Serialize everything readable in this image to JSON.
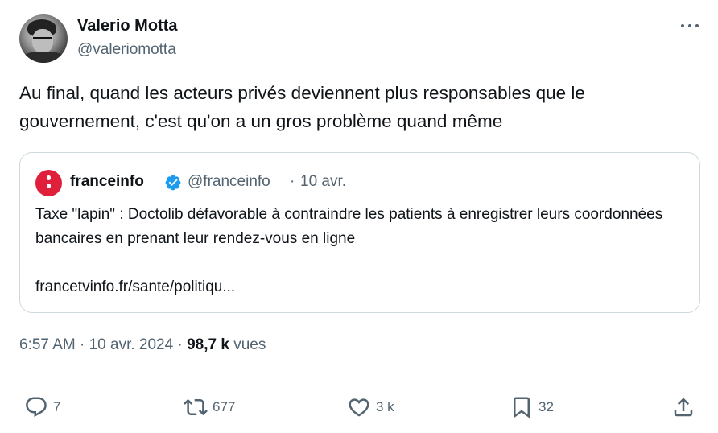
{
  "author": {
    "name": "Valerio Motta",
    "handle": "@valeriomotta"
  },
  "tweet": {
    "text": "Au final, quand les acteurs privés deviennent plus responsables que le gouvernement, c'est qu'on a un gros problème quand même"
  },
  "quote": {
    "name": "franceinfo",
    "handle": "@franceinfo",
    "separator": "·",
    "date": "10 avr.",
    "text": "Taxe \"lapin\" : Doctolib défavorable à contraindre les patients à enregistrer leurs coordonnées bancaires en prenant leur rendez-vous en ligne",
    "link": "francetvinfo.fr/sante/politiqu..."
  },
  "meta": {
    "time": "6:57 AM",
    "sep1": "·",
    "date": "10 avr. 2024",
    "sep2": "·",
    "views_count": "98,7 k",
    "views_label": "vues"
  },
  "actions": {
    "replies": "7",
    "reposts": "677",
    "likes": "3 k",
    "bookmarks": "32"
  },
  "icons": {
    "more": "more-horizontal-icon",
    "verified": "verified-badge-icon",
    "reply": "reply-icon",
    "repost": "repost-icon",
    "like": "heart-icon",
    "bookmark": "bookmark-icon",
    "share": "share-icon"
  },
  "colors": {
    "text": "#0f1419",
    "secondary": "#536471",
    "border": "#cfd9de",
    "verified": "#1d9bf0",
    "franceinfo_red": "#e0203a"
  }
}
